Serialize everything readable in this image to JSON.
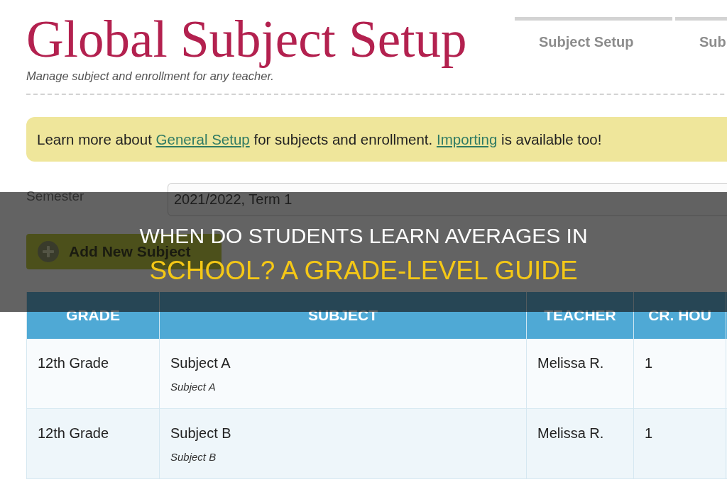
{
  "header": {
    "title": "Global Subject Setup",
    "subtitle": "Manage subject and enrollment for any teacher."
  },
  "tabs": [
    {
      "label": "Subject Setup",
      "selected": false
    },
    {
      "label": "Sub",
      "selected": false
    }
  ],
  "notice": {
    "parts": [
      {
        "kind": "text",
        "text": "Learn more about "
      },
      {
        "kind": "link",
        "text": "General Setup"
      },
      {
        "kind": "text",
        "text": " for subjects and enrollment. "
      },
      {
        "kind": "link",
        "text": "Importing"
      },
      {
        "kind": "text",
        "text": " is available too!"
      }
    ]
  },
  "semester": {
    "label": "Semester",
    "value": "2021/2022, Term 1"
  },
  "add_button": {
    "label": "Add New Subject"
  },
  "table": {
    "columns": [
      "GRADE",
      "SUBJECT",
      "TEACHER",
      "CR. HOU"
    ],
    "rows": [
      {
        "grade": "12th Grade",
        "subject": "Subject A",
        "subject_note": "Subject A",
        "teacher": "Melissa R.",
        "credit_hours": "1"
      },
      {
        "grade": "12th Grade",
        "subject": "Subject B",
        "subject_note": "Subject B",
        "teacher": "Melissa R.",
        "credit_hours": "1"
      }
    ]
  },
  "headline": {
    "top_line": "WHEN DO STUDENTS LEARN AVERAGES IN",
    "bottom_line": "SCHOOL? A GRADE-LEVEL GUIDE"
  }
}
